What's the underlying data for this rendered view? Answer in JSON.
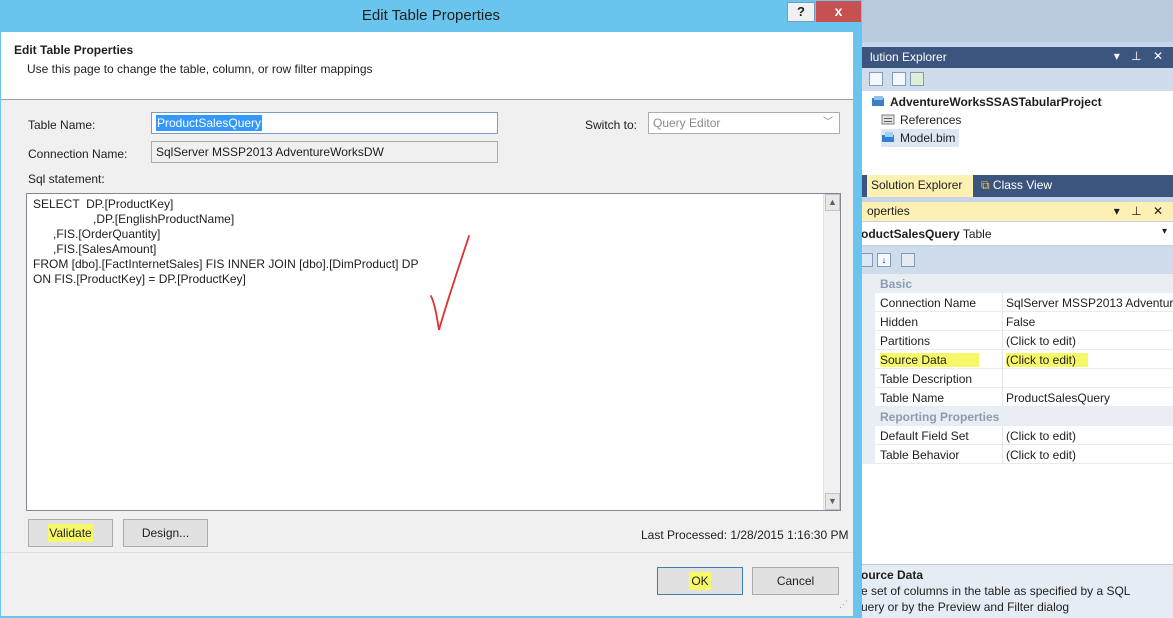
{
  "colors": {
    "dialog_frame": "#6ac5ee",
    "highlight": "#f7f76a",
    "close_button": "#c75050",
    "vs_header": "#3b557e",
    "annotation": "#e03030"
  },
  "dialog": {
    "window_title": "Edit Table Properties",
    "help_label": "?",
    "close_label": "x",
    "header_title": "Edit Table Properties",
    "header_subtitle": "Use this page to change the table, column, or row filter mappings",
    "table_name_label": "Table Name:",
    "table_name_value": "ProductSalesQuery",
    "connection_name_label": "Connection Name:",
    "connection_name_value": "SqlServer MSSP2013 AdventureWorksDW",
    "switch_to_label": "Switch to:",
    "switch_to_value": "Query Editor",
    "sql_label": "Sql statement:",
    "sql_text": "SELECT  DP.[ProductKey]\n                  ,DP.[EnglishProductName]\n      ,FIS.[OrderQuantity]\n      ,FIS.[SalesAmount]\nFROM [dbo].[FactInternetSales] FIS INNER JOIN [dbo].[DimProduct] DP\nON FIS.[ProductKey] = DP.[ProductKey]",
    "validate_label": "Validate",
    "design_label": "Design...",
    "last_processed": "Last Processed: 1/28/2015 1:16:30 PM",
    "ok_label": "OK",
    "cancel_label": "Cancel"
  },
  "solution_explorer": {
    "title": "lution Explorer",
    "pane_controls": "▾ ⊥ ✕",
    "project": "AdventureWorksSSASTabularProject",
    "items": [
      "References",
      "Model.bim"
    ],
    "tabs": [
      "Solution Explorer",
      "Class View"
    ]
  },
  "properties": {
    "title": "operties",
    "pane_controls": "▾ ⊥ ✕",
    "object_name": "oductSalesQuery",
    "object_type": "Table",
    "rows": [
      {
        "name": "Basic",
        "value": "",
        "category": true
      },
      {
        "name": "Connection Name",
        "value": "SqlServer MSSP2013 Adventure"
      },
      {
        "name": "Hidden",
        "value": "False"
      },
      {
        "name": "Partitions",
        "value": "(Click to edit)"
      },
      {
        "name": "Source Data",
        "value": "(Click to edit)",
        "highlight": true
      },
      {
        "name": "Table Description",
        "value": ""
      },
      {
        "name": "Table Name",
        "value": "ProductSalesQuery"
      },
      {
        "name": "Reporting Properties",
        "value": "",
        "category": true
      },
      {
        "name": "Default Field Set",
        "value": "(Click to edit)"
      },
      {
        "name": "Table Behavior",
        "value": "(Click to edit)"
      }
    ],
    "desc_title": "ource Data",
    "desc_line1": "e set of columns in the table as specified by a SQL",
    "desc_line2": "uery or by the Preview and Filter dialog"
  }
}
